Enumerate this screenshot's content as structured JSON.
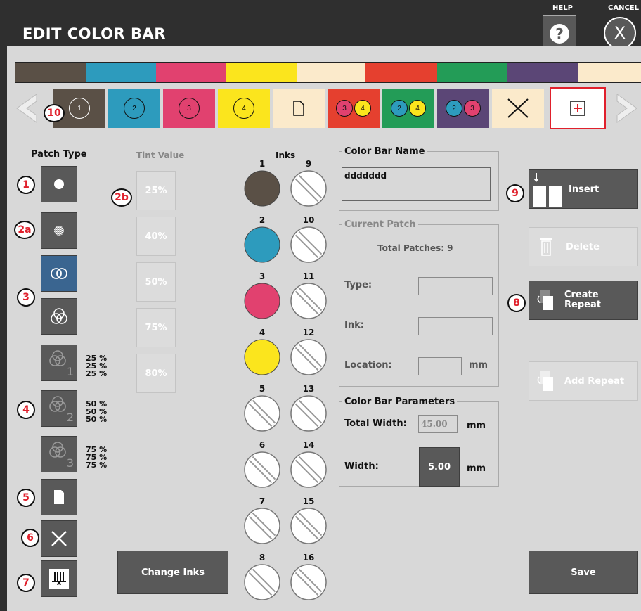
{
  "window": {
    "title": "EDIT COLOR BAR",
    "help_label": "HELP",
    "cancel_label": "CANCEL"
  },
  "color_stripe": [
    "#5a5046",
    "#2d9bbd",
    "#e1416f",
    "#fbe51d",
    "#fbeacb",
    "#e5402f",
    "#239c57",
    "#5b4676",
    "#fbeacb"
  ],
  "patches": [
    {
      "type": "ink",
      "inks": [
        "1"
      ],
      "color": "#5a5046"
    },
    {
      "type": "ink",
      "inks": [
        "2"
      ],
      "color": "#2d9bbd"
    },
    {
      "type": "ink",
      "inks": [
        "3"
      ],
      "color": "#e1416f"
    },
    {
      "type": "ink",
      "inks": [
        "4"
      ],
      "color": "#fbe51d"
    },
    {
      "type": "paper",
      "inks": [],
      "color": "#fbeacb"
    },
    {
      "type": "overprint",
      "inks": [
        "3",
        "4"
      ],
      "color": "#e5402f"
    },
    {
      "type": "overprint",
      "inks": [
        "2",
        "4"
      ],
      "color": "#239c57"
    },
    {
      "type": "overprint",
      "inks": [
        "2",
        "3"
      ],
      "color": "#5b4676"
    },
    {
      "type": "empty",
      "inks": [],
      "color": "#fbeacb"
    }
  ],
  "patch_type": {
    "header": "Patch Type",
    "groups": [
      {
        "name": "gray-balance-1",
        "values": [
          "25 %",
          "25 %",
          "25 %"
        ]
      },
      {
        "name": "gray-balance-2",
        "values": [
          "50 %",
          "50 %",
          "50 %"
        ]
      },
      {
        "name": "gray-balance-3",
        "values": [
          "75 %",
          "75 %",
          "75 %"
        ]
      }
    ]
  },
  "tint_value": {
    "header": "Tint Value",
    "values": [
      "25%",
      "40%",
      "50%",
      "75%",
      "80%"
    ]
  },
  "inks": {
    "header": "Inks",
    "left": [
      {
        "num": "1",
        "color": "#5a5046"
      },
      {
        "num": "2",
        "color": "#2d9bbd"
      },
      {
        "num": "3",
        "color": "#e1416f"
      },
      {
        "num": "4",
        "color": "#fbe51d"
      },
      {
        "num": "5",
        "color": null
      },
      {
        "num": "6",
        "color": null
      },
      {
        "num": "7",
        "color": null
      },
      {
        "num": "8",
        "color": null
      }
    ],
    "right": [
      "9",
      "10",
      "11",
      "12",
      "13",
      "14",
      "15",
      "16"
    ]
  },
  "change_inks_label": "Change Inks",
  "color_bar_name": {
    "legend": "Color Bar Name",
    "value": "ddddddd"
  },
  "current_patch": {
    "legend": "Current Patch",
    "total": "Total Patches: 9",
    "type_label": "Type:",
    "ink_label": "Ink:",
    "location_label": "Location:",
    "location_unit": "mm"
  },
  "parameters": {
    "legend": "Color Bar Parameters",
    "total_width_label": "Total Width:",
    "total_width_value": "45.00",
    "total_width_unit": "mm",
    "width_label": "Width:",
    "width_value": "5.00",
    "width_unit": "mm"
  },
  "actions": {
    "insert": "Insert",
    "delete": "Delete",
    "create_repeat": [
      "Create",
      "Repeat"
    ],
    "add_repeat": "Add Repeat",
    "save": "Save"
  },
  "callouts": {
    "patch_area": "10",
    "solid": "1",
    "tint": "2a",
    "tint_value": "2b",
    "overprint": "3",
    "gray_balance": "4",
    "paper": "5",
    "empty": "6",
    "slur": "7",
    "create_repeat": "8",
    "insert": "9"
  }
}
